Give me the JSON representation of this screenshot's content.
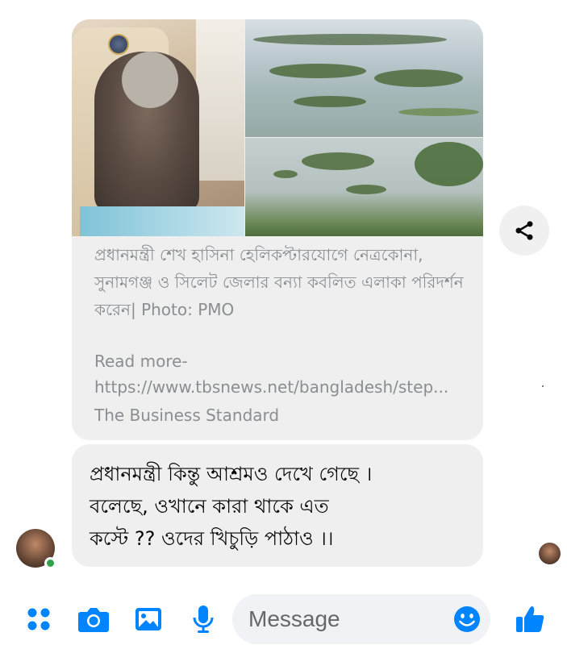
{
  "shared_post": {
    "caption": "প্রধানমন্ত্রী শেখ হাসিনা হেলিকপ্টারযোগে নেত্রকোনা, সুনামগঞ্জ ও সিলেট জেলার বন্যা কবলিত এলাকা পরিদর্শন করেন| Photo: PMO",
    "read_more_label": "Read more-",
    "read_more_url": "https://www.tbsnews.net/bangladesh/step...",
    "source": "The Business Standard"
  },
  "message": {
    "line1": "প্রধানমন্ত্রী কিন্তু আশ্রমও দেখে গেছে ।",
    "line2": "বলেছে, ওখানে কারা থাকে এত",
    "line3": "কস্টে ?? ওদের খিচুড়ি পাঠাও ।।"
  },
  "composer": {
    "placeholder": "Message"
  },
  "colors": {
    "accent": "#0084ff",
    "bubble": "#efefef",
    "online": "#31a24c"
  },
  "icons": [
    "share-icon",
    "menu-dots-icon",
    "camera-icon",
    "gallery-icon",
    "microphone-icon",
    "emoji-icon",
    "thumbs-up-icon"
  ]
}
